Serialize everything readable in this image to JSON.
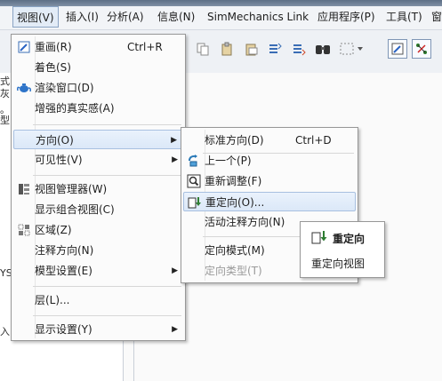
{
  "menubar": {
    "items": [
      {
        "label": "视图(V)",
        "active": true
      },
      {
        "label": "插入(I)"
      },
      {
        "label": "分析(A)"
      },
      {
        "label": "信息(N)"
      },
      {
        "label": "SimMechanics Link"
      },
      {
        "label": "应用程序(P)"
      },
      {
        "label": "工具(T)"
      },
      {
        "label": "窗"
      }
    ]
  },
  "left_panel": {
    "fragments": [
      "式",
      "灰",
      "。",
      "型",
      "YS",
      "入"
    ]
  },
  "view_menu": {
    "items": [
      {
        "label": "重画(R)",
        "shortcut": "Ctrl+R",
        "icon": "redraw-icon"
      },
      {
        "label": "着色(S)"
      },
      {
        "label": "渲染窗口(D)",
        "icon": "render-teapot-icon"
      },
      {
        "label": "增强的真实感(A)"
      },
      {
        "label": "方向(O)",
        "submenu": true,
        "highlighted": true
      },
      {
        "label": "可见性(V)",
        "submenu": true
      },
      {
        "label": "视图管理器(W)",
        "icon": "view-manager-icon"
      },
      {
        "label": "显示组合视图(C)"
      },
      {
        "label": "区域(Z)",
        "icon": "zone-icon"
      },
      {
        "label": "注释方向(N)"
      },
      {
        "label": "模型设置(E)",
        "submenu": true
      },
      {
        "label": "层(L)..."
      },
      {
        "label": "显示设置(Y)",
        "submenu": true
      }
    ]
  },
  "orientation_menu": {
    "items": [
      {
        "label": "标准方向(D)",
        "shortcut": "Ctrl+D"
      },
      {
        "label": "上一个(P)",
        "icon": "previous-view-icon"
      },
      {
        "label": "重新调整(F)",
        "icon": "refit-icon"
      },
      {
        "label": "重定向(O)...",
        "icon": "reorient-icon",
        "highlighted": true
      },
      {
        "label": "活动注释方向(N)"
      },
      {
        "label": "定向模式(M)"
      },
      {
        "label": "定向类型(T)",
        "disabled": true
      }
    ]
  },
  "tooltip": {
    "title": "重定向",
    "description": "重定向视图"
  },
  "colors": {
    "highlight": "#dbe8f8",
    "highlight_border": "#a8c0e0",
    "menu_bg": "#fbfbfb",
    "disabled_text": "#9a9a9a"
  }
}
